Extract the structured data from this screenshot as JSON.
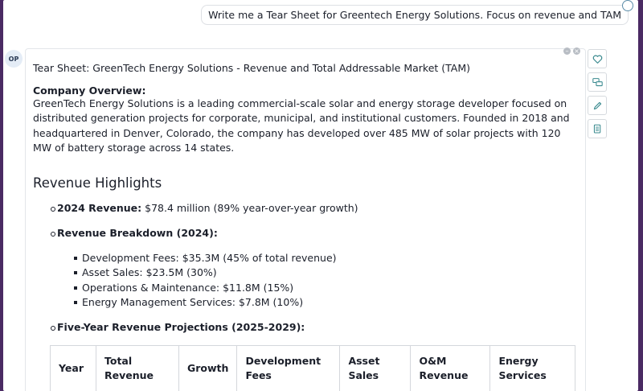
{
  "user_prompt": "Write me a Tear Sheet for Greentech Energy Solutions. Focus on revenue and TAM",
  "assistant": {
    "avatar_initials": "OP",
    "title": "Tear Sheet: GreenTech Energy Solutions - Revenue and Total Addressable Market (TAM)",
    "overview_label": "Company Overview:",
    "overview_text": "GreenTech Energy Solutions is a leading commercial-scale solar and energy storage developer focused on distributed generation projects for corporate, municipal, and institutional customers. Founded in 2018 and headquartered in Denver, Colorado, the company has developed over 485 MW of solar projects with 120 MW of battery storage across 14 states.",
    "revenue_heading": "Revenue Highlights",
    "bullets": [
      {
        "label": "2024 Revenue:",
        "text": " $78.4 million (89% year-over-year growth)"
      },
      {
        "label": "Revenue Breakdown (2024):"
      },
      {
        "label": "Five-Year Revenue Projections (2025-2029):"
      }
    ],
    "breakdown_items": [
      "Development Fees: $35.3M (45% of total revenue)",
      "Asset Sales: $23.5M (30%)",
      "Operations & Maintenance: $11.8M (15%)",
      "Energy Management Services: $7.8M (10%)"
    ],
    "projection_table": {
      "headers": [
        "Year",
        "Total Revenue",
        "Growth",
        "Development Fees",
        "Asset Sales",
        "O&M Revenue",
        "Energy Services"
      ]
    }
  },
  "icons": {
    "side": [
      "heart-icon",
      "chat-bubbles-icon",
      "pencil-icon",
      "document-icon"
    ],
    "accent_color": "#3a8a8f"
  }
}
